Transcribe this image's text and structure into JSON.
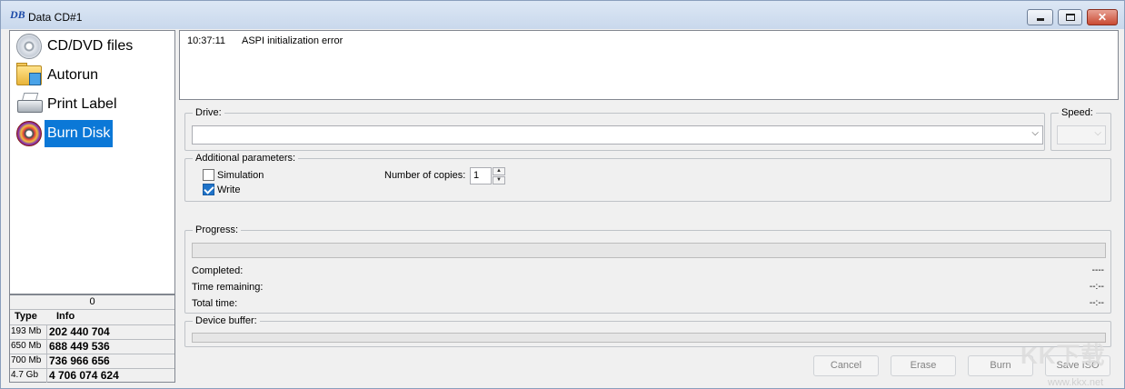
{
  "window": {
    "title": "Data CD#1",
    "icon_text": "DB",
    "controls": {
      "minimize": "minimize",
      "maximize": "maximize",
      "close": "✕"
    }
  },
  "nav": {
    "items": [
      {
        "label": "CD/DVD files",
        "icon": "cd-icon"
      },
      {
        "label": "Autorun",
        "icon": "folder-icon"
      },
      {
        "label": "Print Label",
        "icon": "printer-icon"
      },
      {
        "label": "Burn Disk",
        "icon": "burn-cd-icon",
        "selected": true
      }
    ]
  },
  "sizes": {
    "total": "0",
    "headers": {
      "type": "Type",
      "info": "Info"
    },
    "rows": [
      {
        "type": "193 Mb",
        "info": "202 440 704"
      },
      {
        "type": "650 Mb",
        "info": "688 449 536"
      },
      {
        "type": "700 Mb",
        "info": "736 966 656"
      },
      {
        "type": "4.7 Gb",
        "info": "4 706 074 624"
      }
    ]
  },
  "log": {
    "entries": [
      {
        "time": "10:37:11",
        "message": "ASPI initialization error"
      }
    ]
  },
  "drive": {
    "label": "Drive:",
    "value": ""
  },
  "speed": {
    "label": "Speed:",
    "value": ""
  },
  "params": {
    "label": "Additional parameters:",
    "simulation": {
      "label": "Simulation",
      "checked": false
    },
    "write": {
      "label": "Write",
      "checked": true
    },
    "copies": {
      "label": "Number of copies:",
      "value": "1"
    }
  },
  "progress": {
    "label": "Progress:",
    "fraction": 0,
    "completed": {
      "label": "Completed:",
      "value": "----"
    },
    "time_remaining": {
      "label": "Time remaining:",
      "value": "--:--"
    },
    "total_time": {
      "label": "Total time:",
      "value": "--:--"
    }
  },
  "buffer": {
    "label": "Device buffer:",
    "fraction": 0
  },
  "buttons": {
    "cancel": "Cancel",
    "erase": "Erase",
    "burn": "Burn",
    "save_iso": "Save ISO"
  },
  "watermark": {
    "badge": "KK下载",
    "url": "www.kkx.net"
  },
  "colors": {
    "selection": "#0b78d7",
    "accent": "#1f73c9",
    "disabled_text": "#838383"
  }
}
